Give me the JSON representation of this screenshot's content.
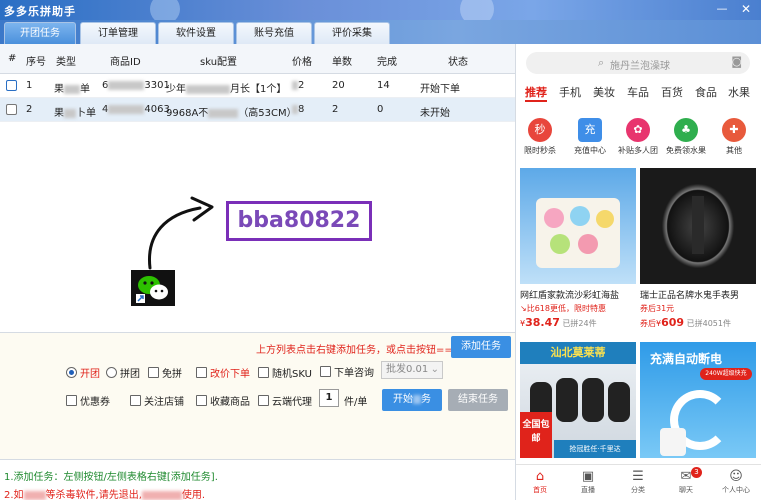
{
  "window": {
    "title": "多多乐拼助手",
    "minimize": "—",
    "close": "✕"
  },
  "tabs": [
    {
      "label": "开团任务"
    },
    {
      "label": "订单管理"
    },
    {
      "label": "软件设置"
    },
    {
      "label": "账号充值"
    },
    {
      "label": "评价采集"
    }
  ],
  "table": {
    "headers": [
      "#",
      "序号",
      "类型",
      "商品ID",
      "sku配置",
      "价格",
      "单数",
      "完成",
      "状态"
    ],
    "rows": [
      {
        "index": "1",
        "type_prefix": "果",
        "type_suffix": "单",
        "id_prefix": "6",
        "id_suffix": "3301",
        "sku_prefix": "少年",
        "sku_suffix": "月长【1个】",
        "price_suffix": "2",
        "qty": "20",
        "done": "14",
        "status": "开始下单"
      },
      {
        "index": "2",
        "type_prefix": "果",
        "type_suffix": "卜单",
        "id_prefix": "4",
        "id_suffix": "4063",
        "sku_prefix": "9968A不",
        "sku_suffix": "（高53CM）",
        "price_suffix": "8",
        "qty": "2",
        "done": "0",
        "status": "未开始"
      }
    ]
  },
  "overlay": {
    "promo_text": "bba80822"
  },
  "controls": {
    "tip": "上方列表点击右键添加任务，或点击按钮==>>",
    "add_task": "添加任务",
    "radio_open": "开团",
    "radio_join": "拼团",
    "free_ship": "免拼",
    "change_price": "改价下单",
    "random_sku": "随机SKU",
    "order_consult": "下单咨询",
    "batch_select": "批发0.01",
    "coupon": "优惠券",
    "follow_store": "关注店铺",
    "fav_goods": "收藏商品",
    "cloud_proxy": "云端代理",
    "per_order_value": "1",
    "per_order_unit": "件/单",
    "start_order": "开始",
    "start_order_suffix": "务",
    "end_task": "结束任务"
  },
  "help": {
    "line1": "1.添加任务：左侧按钮/左侧表格右键[添加任务].",
    "line2_prefix": "2.如",
    "line2_mid": "等杀毒软件,请先退出,",
    "line2_suffix": "使用."
  },
  "shop": {
    "search_placeholder": "施丹兰泡澡球",
    "categories": [
      "推荐",
      "手机",
      "美妆",
      "车品",
      "百货",
      "食品",
      "水果"
    ],
    "icons": [
      {
        "label": "限时秒杀",
        "glyph": "秒",
        "color": "#e8463c"
      },
      {
        "label": "充值中心",
        "glyph": "充",
        "color": "#3f8ee8"
      },
      {
        "label": "补贴多人团",
        "glyph": "✿",
        "color": "#e8356e"
      },
      {
        "label": "免费领水果",
        "glyph": "♣",
        "color": "#2fae4e"
      },
      {
        "label": "其他",
        "glyph": "✚",
        "color": "#e85a3c"
      }
    ],
    "products": [
      {
        "name": "网红盾家款流沙彩虹海盐",
        "sub": "↘比618更低，限时特惠",
        "price_symbol": "¥",
        "price": "38.47",
        "sold": "已拼24件"
      },
      {
        "name": "瑞士正品名牌水鬼手表男",
        "sub": "券后31元",
        "price_symbol": "券后¥",
        "price": "609",
        "sold": "已拼4051件"
      },
      {
        "name": "全国包邮",
        "sub": "",
        "price_symbol": "",
        "price": "",
        "sold": "",
        "promo": "汕北莫莱蒂",
        "foot": "抢冠胜任·千里达"
      },
      {
        "name": "充满自动断电",
        "sub": "240W超级快充",
        "price_symbol": "",
        "price": "",
        "sold": ""
      }
    ],
    "nav": [
      {
        "label": "首页",
        "glyph": "⌂"
      },
      {
        "label": "直播",
        "glyph": "▣"
      },
      {
        "label": "分类",
        "glyph": "☰"
      },
      {
        "label": "聊天",
        "glyph": "✉"
      },
      {
        "label": "个人中心",
        "glyph": "☺"
      }
    ],
    "chat_badge": "3"
  }
}
